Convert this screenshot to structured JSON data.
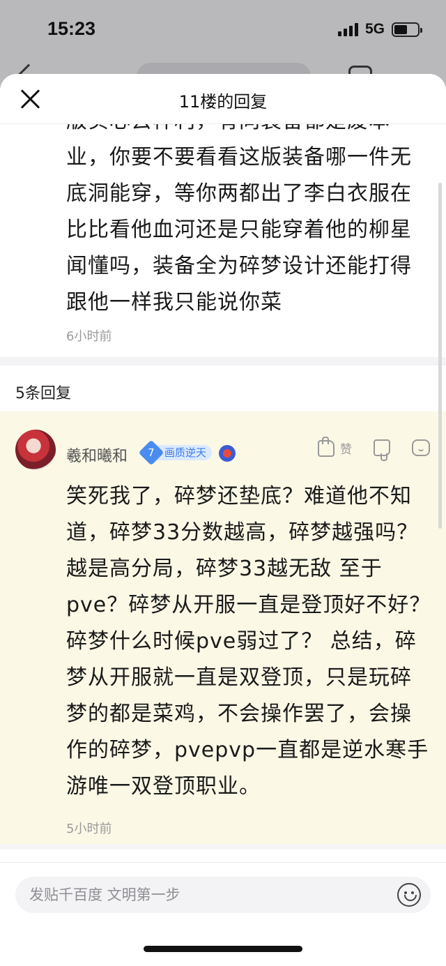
{
  "status_bar": {
    "time": "15:23",
    "network": "5G",
    "battery_level": 0.55
  },
  "sheet": {
    "title": "11楼的回复"
  },
  "main_post": {
    "text": "版实心去样利，有同装备都是废本业，你要不要看看这版装备哪一件无底洞能穿，等你两都出了李白衣服在比比看他血河还是只能穿着他的柳星闻懂吗，装备全为碎梦设计还能打得跟他一样我只能说你菜",
    "time": "6小时前"
  },
  "replies_header": {
    "count_label": "5条回复"
  },
  "reply": {
    "username": "羲和曦和",
    "level": "7",
    "level_title": "画质逆天",
    "like_label": "赞",
    "text": "笑死我了，碎梦还垫底？难道他不知道，碎梦33分数越高，碎梦越强吗？越是高分局，碎梦33越无敌 至于pve？碎梦从开服一直是登顶好不好？碎梦什么时候pve弱过了？ 总结，碎梦从开服就一直是双登顶，只是玩碎梦的都是菜鸡，不会操作罢了，会操作的碎梦，pvepvp一直都是逆水寒手游唯一双登顶职业。",
    "time": "5小时前"
  },
  "input": {
    "placeholder": "发贴千百度 文明第一步"
  },
  "colors": {
    "reply_card_bg": "#fbf8e6",
    "badge_blue": "#4a8cf0",
    "badge_bg": "#dbe9ff"
  }
}
